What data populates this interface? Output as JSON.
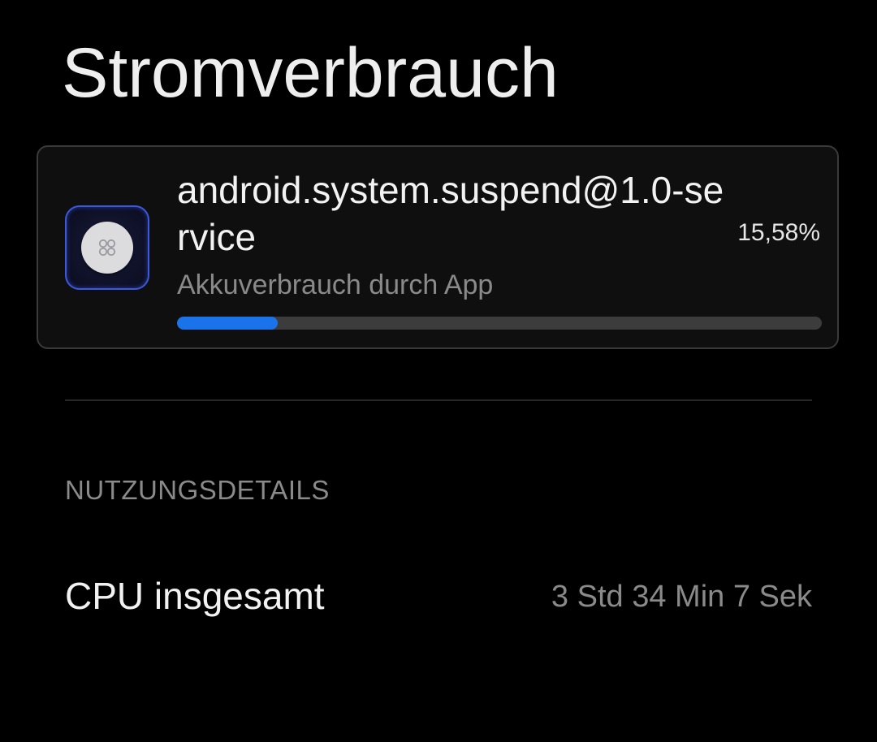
{
  "page": {
    "title": "Stromverbrauch"
  },
  "app_card": {
    "name": "android.system.suspend@1.0-service",
    "percent": "15,58%",
    "subtitle": "Akkuverbrauch durch App",
    "usage_fraction": 0.1558,
    "icon": "android-system-icon",
    "accent_color": "#1a73e8",
    "icon_border_color": "#3b58e0"
  },
  "usage_details": {
    "header": "NUTZUNGSDETAILS",
    "rows": [
      {
        "label": "CPU insgesamt",
        "value": "3 Std 34 Min 7 Sek"
      }
    ]
  }
}
